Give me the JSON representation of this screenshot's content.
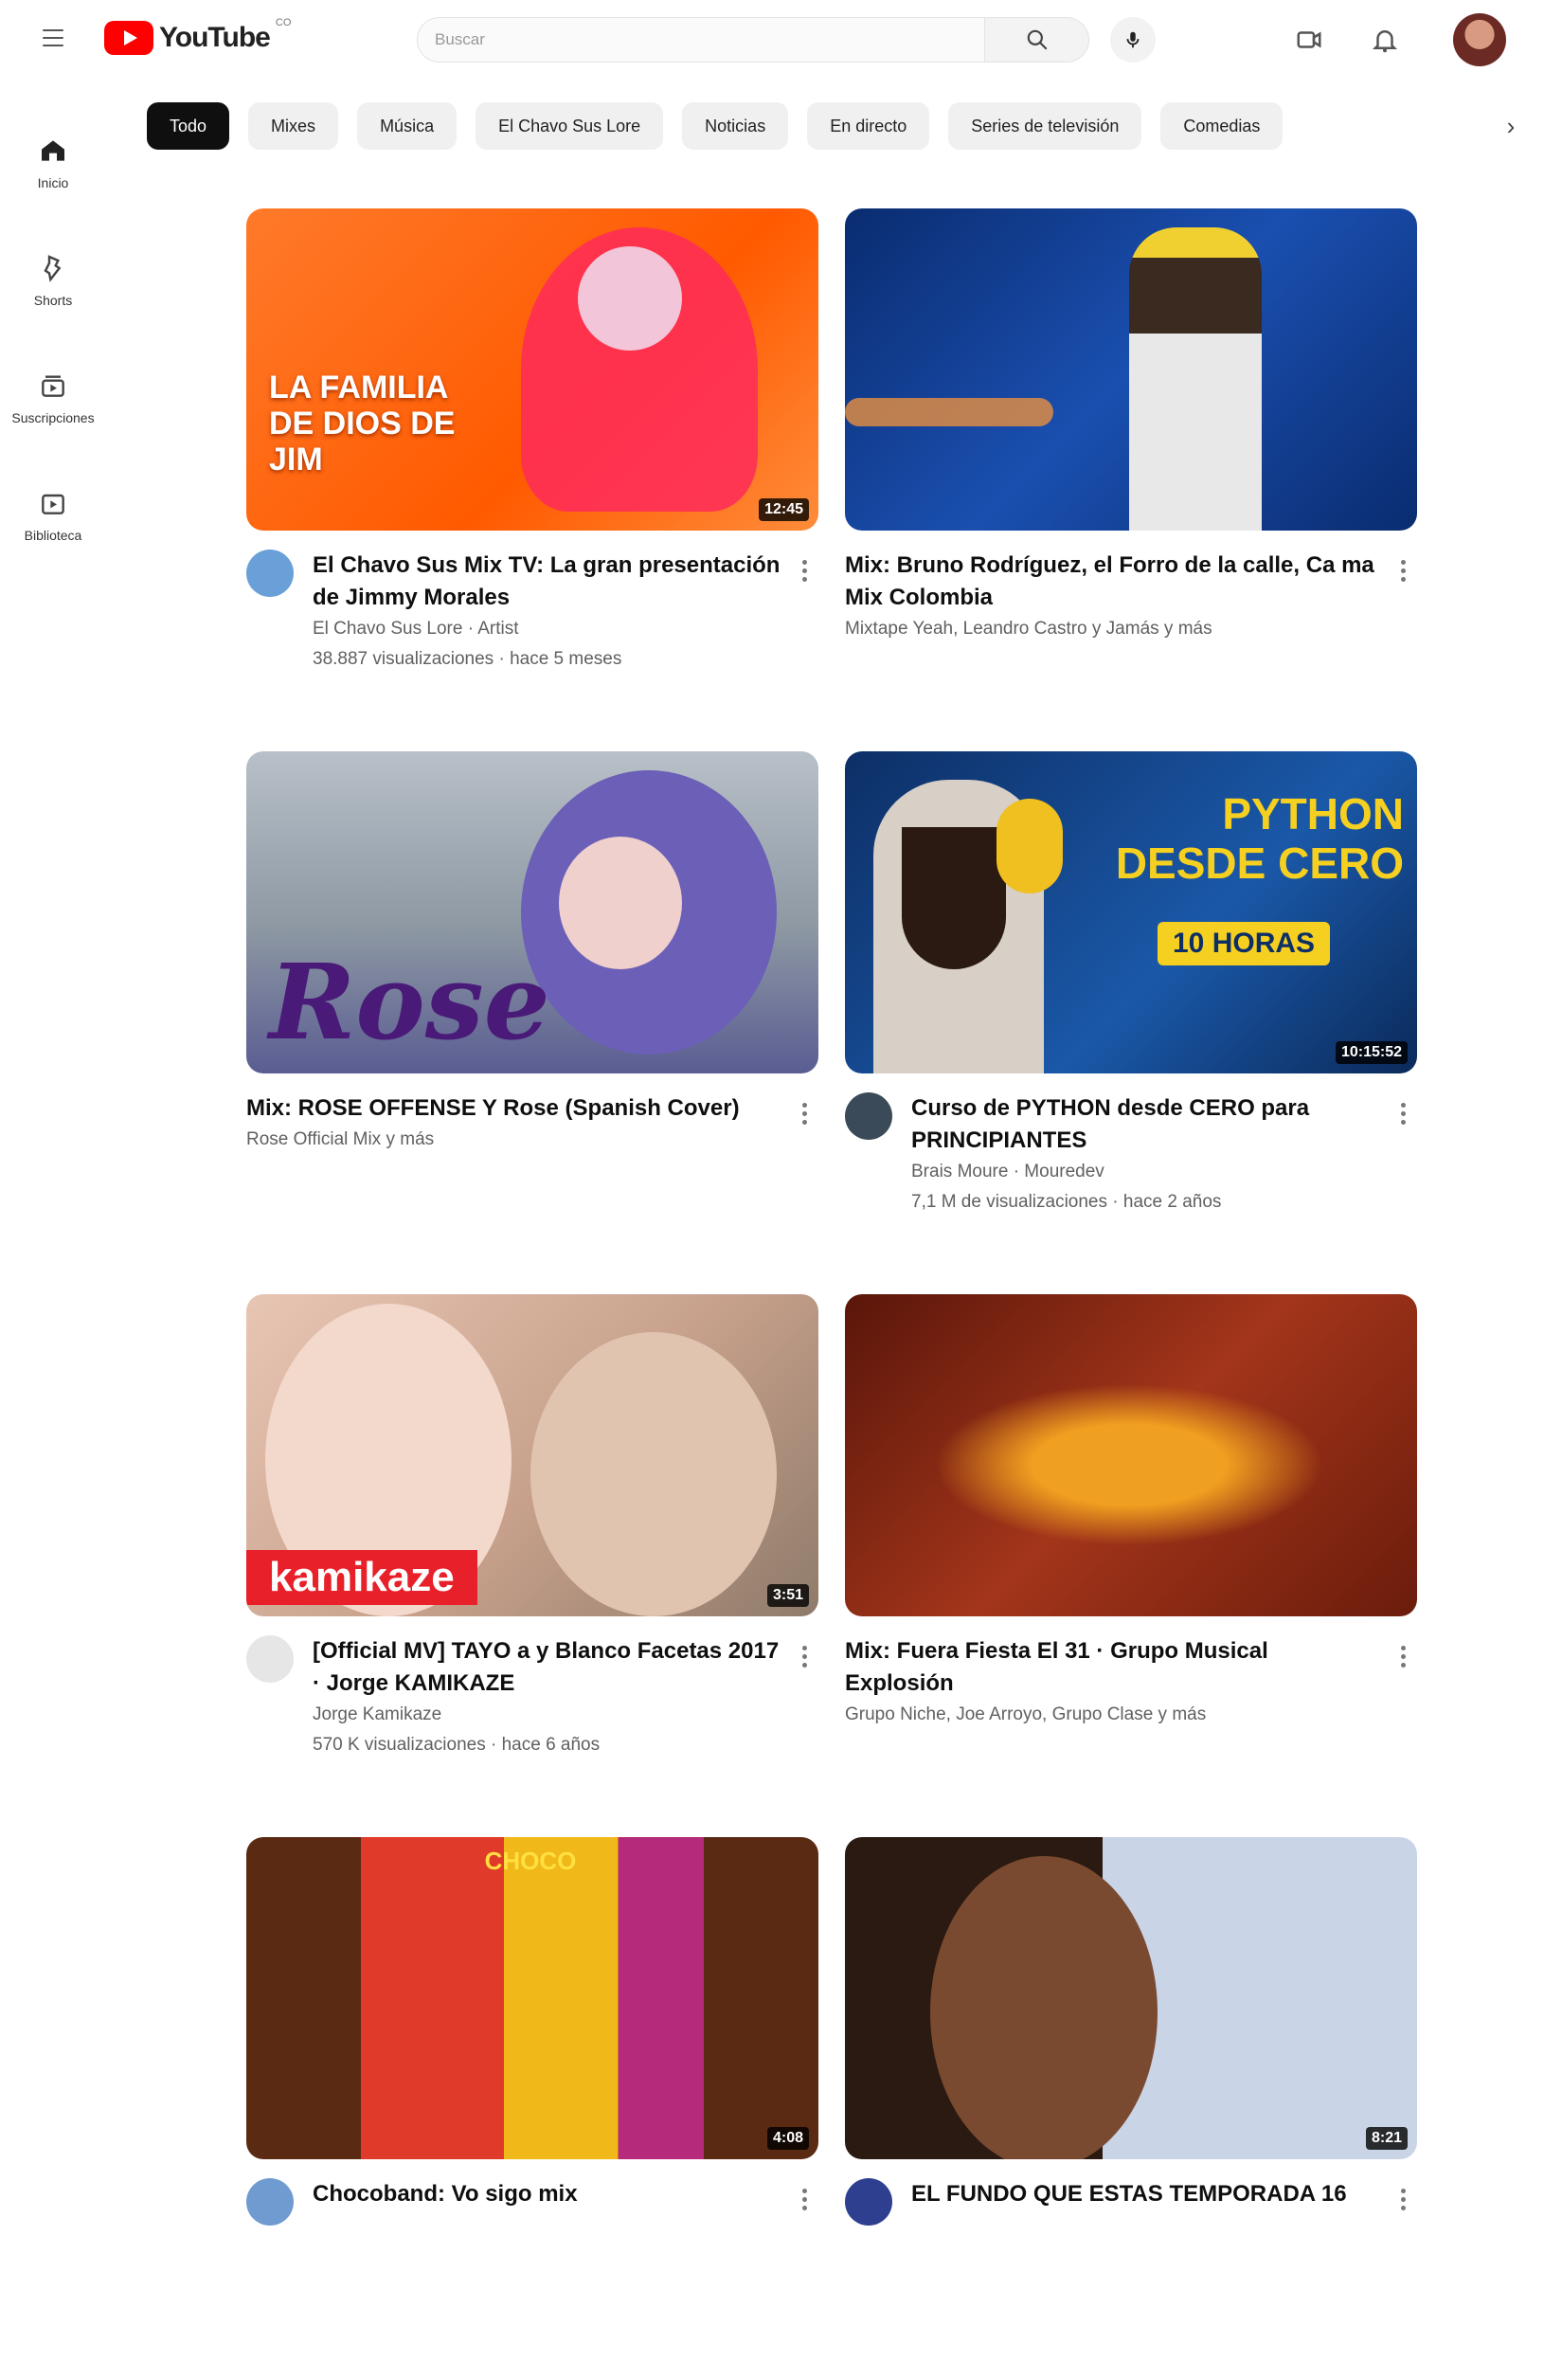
{
  "header": {
    "logo_text": "YouTube",
    "logo_country": "CO",
    "search_placeholder": "Buscar"
  },
  "chips": [
    {
      "label": "Todo",
      "active": true
    },
    {
      "label": "Mixes",
      "active": false
    },
    {
      "label": "Música",
      "active": false
    },
    {
      "label": "El Chavo Sus Lore",
      "active": false
    },
    {
      "label": "Noticias",
      "active": false
    },
    {
      "label": "En directo",
      "active": false
    },
    {
      "label": "Series de televisión",
      "active": false
    },
    {
      "label": "Comedias",
      "active": false
    }
  ],
  "sidebar": [
    {
      "label": "Inicio",
      "icon": "home-icon"
    },
    {
      "label": "Shorts",
      "icon": "shorts-icon"
    },
    {
      "label": "Suscripciones",
      "icon": "subscriptions-icon"
    },
    {
      "label": "Biblioteca",
      "icon": "library-icon"
    }
  ],
  "videos": [
    {
      "title": "El Chavo Sus Mix TV: La gran presentación de Jimmy Morales",
      "channel": "El Chavo Sus Lore · Artist",
      "stats": "38.887 visualizaciones · hace 5 meses",
      "duration": "12:45",
      "thumb_text": "LA FAMILIA DE DIOS DE JIM",
      "has_avatar": true,
      "avatar_color": "#6aa0d8"
    },
    {
      "title": "Mix: Bruno Rodríguez, el Forro de la calle, Ca ma Mix Colombia",
      "channel": "Mixtape Yeah, Leandro Castro y Jamás y más",
      "stats": "",
      "duration": "",
      "thumb_text": "",
      "has_avatar": false,
      "avatar_color": ""
    },
    {
      "title": "Mix: ROSE OFFENSE Y Rose (Spanish Cover)",
      "channel": "Rose Official Mix y más",
      "stats": "",
      "duration": "",
      "thumb_text": "Rose",
      "has_avatar": false,
      "avatar_color": ""
    },
    {
      "title": "Curso de PYTHON desde CERO para PRINCIPIANTES",
      "channel": "Brais Moure · Mouredev",
      "stats": "7,1 M de visualizaciones · hace 2 años",
      "duration": "10:15:52",
      "thumb_text": "PYTHON DESDE CERO",
      "thumb_badge": "10 HORAS",
      "has_avatar": true,
      "avatar_color": "#3a4a58"
    },
    {
      "title": "[Official MV] TAYO a y Blanco Facetas 2017 · Jorge KAMIKAZE",
      "channel": "Jorge Kamikaze",
      "stats": "570 K visualizaciones · hace 6 años",
      "duration": "3:51",
      "thumb_text": "kamikaze",
      "has_avatar": true,
      "avatar_color": "#e6e6e6"
    },
    {
      "title": "Mix: Fuera Fiesta El 31 · Grupo Musical Explosión",
      "channel": "Grupo Niche, Joe Arroyo, Grupo Clase y más",
      "stats": "",
      "duration": "",
      "thumb_text": "",
      "has_avatar": false,
      "avatar_color": ""
    },
    {
      "title": "Chocoband: Vo sigo mix",
      "channel": "",
      "stats": "",
      "duration": "4:08",
      "thumb_text": "CHOCO",
      "has_avatar": true,
      "avatar_color": "#6f9bd0"
    },
    {
      "title": "EL FUNDO QUE ESTAS TEMPORADA 16",
      "channel": "",
      "stats": "",
      "duration": "8:21",
      "thumb_text": "",
      "has_avatar": true,
      "avatar_color": "#2d3f8e"
    }
  ]
}
